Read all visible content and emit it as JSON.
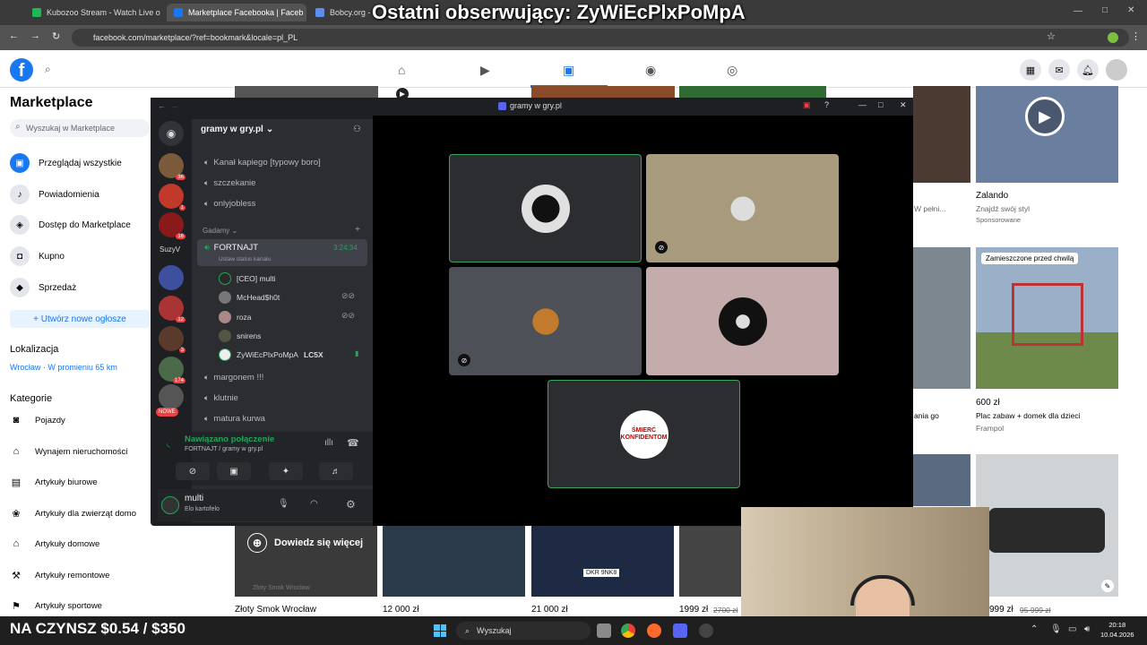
{
  "overlay_title": "Ostatni obserwujący: ZyWiEcPlxPoMpA",
  "browser": {
    "tabs": [
      {
        "label": "Kubozoo Stream - Watch Live o",
        "color": "#1db954"
      },
      {
        "label": "Marketplace Facebooka | Faceb",
        "color": "#1877f2"
      },
      {
        "label": "Bobcy.org - Ro",
        "color": "#5b8def"
      }
    ],
    "url": "facebook.com/marketplace/?ref=bookmark&locale=pl_PL"
  },
  "facebook": {
    "logo": "f",
    "sidebar": {
      "title": "Marketplace",
      "search_placeholder": "Wyszukaj w Marketplace",
      "items": [
        {
          "label": "Przeglądaj wszystkie",
          "icon": "storefront-icon"
        },
        {
          "label": "Powiadomienia",
          "icon": "bell-icon"
        },
        {
          "label": "Dostęp do Marketplace",
          "icon": "shield-icon"
        },
        {
          "label": "Kupno",
          "icon": "bag-icon"
        },
        {
          "label": "Sprzedaż",
          "icon": "tag-icon"
        }
      ],
      "create_label": "+ Utwórz nowe ogłosze",
      "location_heading": "Lokalizacja",
      "location_value": "Wrocław · W promieniu 65 km",
      "categories_heading": "Kategorie",
      "categories": [
        {
          "label": "Pojazdy",
          "icon": "car-icon"
        },
        {
          "label": "Wynajem nieruchomości",
          "icon": "house-icon"
        },
        {
          "label": "Artykuły biurowe",
          "icon": "briefcase-icon"
        },
        {
          "label": "Artykuły dla zwierząt domo",
          "icon": "paw-icon"
        },
        {
          "label": "Artykuły domowe",
          "icon": "home-icon"
        },
        {
          "label": "Artykuły remontowe",
          "icon": "hammer-icon"
        },
        {
          "label": "Artykuły sportowe",
          "icon": "runner-icon"
        }
      ]
    },
    "listings": {
      "zalando_title": "Zalando",
      "zalando_sub1": "Znajdź swój styl",
      "zalando_sub2": "Sponsorowane",
      "left_sub1": "W pełni...",
      "placeholder_label": "Zamieszczone przed chwilą",
      "price_600": "600 zł",
      "desc_600": "Plac zabaw + domek dla dzieci",
      "loc_600": "Frampol",
      "left_price": "ania go",
      "price_1": "12 000 zł",
      "price_2": "21 000 zł",
      "price_3": "1999 zł",
      "price_3_old": "2700 zł",
      "price_4": "999 zł",
      "price_4_old": "95 999 zł",
      "left_listing": "Złoty Smok Wrocław",
      "resume_label": "Wznów film",
      "learn_more_label": "Dowiedz się więcej",
      "tile_watermark": "Złoty Smok Wrocław",
      "plate": "DKR 9NK8"
    }
  },
  "discord": {
    "window_title": "gramy w gry.pl",
    "server_name": "gramy w gry.pl",
    "server_list_label": "SuzyV",
    "server_badges": [
      "36",
      "1",
      "16",
      "12",
      "3",
      "174"
    ],
    "new_badge": "NOWE",
    "channels_top": [
      "Kanał kapiego [typowy boro]",
      "szczekanie",
      "onlyjobless"
    ],
    "category": "Gadamy",
    "active_channel": "FORTNAJT",
    "active_channel_time": "3:24:34",
    "active_channel_status": "Ustaw status kanału",
    "voice_users": [
      {
        "name": "[CEO] multi",
        "muted": false
      },
      {
        "name": "McHead$h0t",
        "muted": true
      },
      {
        "name": "roza",
        "muted": true
      },
      {
        "name": "snirens",
        "muted": false
      },
      {
        "name": "ZyWiEcPlxPoMpA",
        "muted": false,
        "tag": "LC5X"
      }
    ],
    "channels_bottom": [
      "margonem !!!",
      "klutnie",
      "matura kurwa"
    ],
    "voice_status": "Nawiązano połączenie",
    "voice_location": "FORTNAJT / gramy w gry.pl",
    "user_name": "multi",
    "user_status": "Elo kartofelo",
    "end_tile_text": "ŚMIERĆ KONFIDENTOM"
  },
  "taskbar": {
    "rent_text": "NA CZYNSZ $0.54 / $350",
    "search_label": "Wyszukaj",
    "time": "20:18",
    "date": "10.04.2026"
  },
  "colors": {
    "facebook_blue": "#1877f2",
    "discord_bg": "#1e1f22",
    "discord_panel": "#2b2d31",
    "speaking_green": "#3ba55c",
    "connected_green": "#23a55a"
  }
}
